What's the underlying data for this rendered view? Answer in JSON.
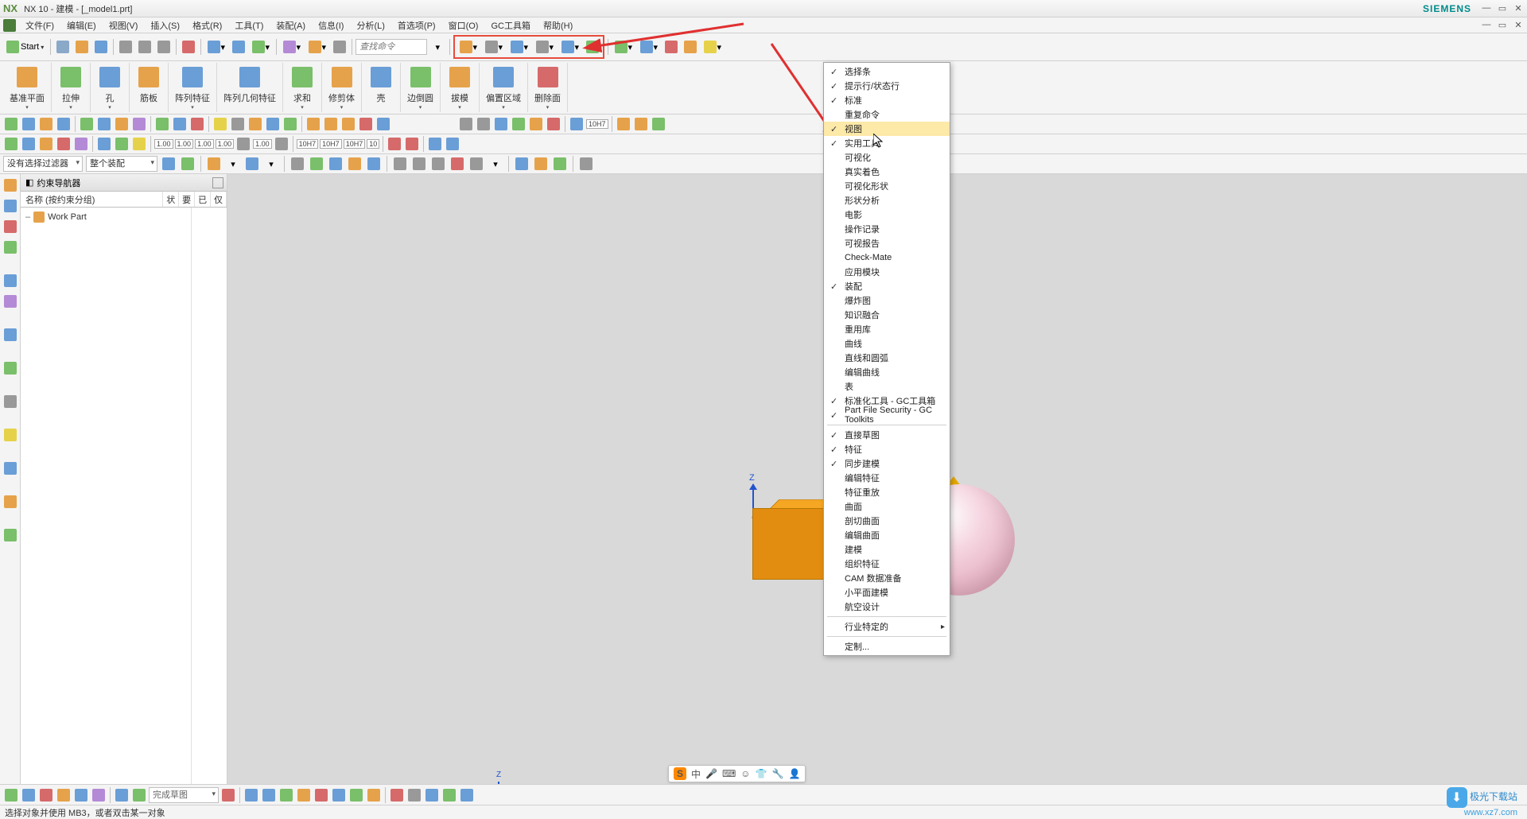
{
  "title": {
    "app": "NX",
    "full": "NX 10 - 建模 - [_model1.prt]",
    "brand": "SIEMENS"
  },
  "menus": [
    "文件(F)",
    "编辑(E)",
    "视图(V)",
    "插入(S)",
    "格式(R)",
    "工具(T)",
    "装配(A)",
    "信息(I)",
    "分析(L)",
    "首选项(P)",
    "窗口(O)",
    "GC工具箱",
    "帮助(H)"
  ],
  "toolbar1": {
    "start": "Start",
    "search_placeholder": "查找命令"
  },
  "ribbon": [
    {
      "label": "基准平面"
    },
    {
      "label": "拉伸"
    },
    {
      "label": "孔"
    },
    {
      "label": "筋板"
    },
    {
      "label": "阵列特征"
    },
    {
      "label": "阵列几何特征"
    },
    {
      "label": "求和"
    },
    {
      "label": "修剪体"
    },
    {
      "label": "壳"
    },
    {
      "label": "边倒圆"
    },
    {
      "label": "拔模"
    },
    {
      "label": "偏置区域"
    },
    {
      "label": "删除面"
    }
  ],
  "dim_values": [
    "1.00",
    "1.00",
    "1.00",
    "1.00",
    "1.00",
    "10H7",
    "10H7",
    "10H7",
    "10"
  ],
  "filter": {
    "no_filter": "没有选择过滤器",
    "assembly": "整个装配"
  },
  "nav": {
    "title": "约束导航器",
    "col1": "名称 (按约束分组)",
    "cols": [
      "状",
      "要",
      "已",
      "仅"
    ],
    "item": "Work Part"
  },
  "ctx": {
    "items": [
      {
        "t": "选择条",
        "c": true
      },
      {
        "t": "提示行/状态行",
        "c": true
      },
      {
        "t": "标准",
        "c": true
      },
      {
        "t": "重复命令",
        "c": false
      },
      {
        "t": "视图",
        "c": true,
        "hover": true
      },
      {
        "t": "实用工具",
        "c": true
      },
      {
        "t": "可视化",
        "c": false
      },
      {
        "t": "真实着色",
        "c": false
      },
      {
        "t": "可视化形状",
        "c": false
      },
      {
        "t": "形状分析",
        "c": false
      },
      {
        "t": "电影",
        "c": false
      },
      {
        "t": "操作记录",
        "c": false
      },
      {
        "t": "可视报告",
        "c": false
      },
      {
        "t": "Check-Mate",
        "c": false
      },
      {
        "t": "应用模块",
        "c": false
      },
      {
        "t": "装配",
        "c": true
      },
      {
        "t": "爆炸图",
        "c": false
      },
      {
        "t": "知识融合",
        "c": false
      },
      {
        "t": "重用库",
        "c": false
      },
      {
        "t": "曲线",
        "c": false
      },
      {
        "t": "直线和圆弧",
        "c": false
      },
      {
        "t": "编辑曲线",
        "c": false
      },
      {
        "t": "表",
        "c": false
      },
      {
        "t": "标准化工具 - GC工具箱",
        "c": true
      },
      {
        "t": "Part File Security - GC Toolkits",
        "c": true
      },
      {
        "sep": true
      },
      {
        "t": "直接草图",
        "c": true
      },
      {
        "t": "特征",
        "c": true
      },
      {
        "t": "同步建模",
        "c": true
      },
      {
        "t": "编辑特征",
        "c": false
      },
      {
        "t": "特征重放",
        "c": false
      },
      {
        "t": "曲面",
        "c": false
      },
      {
        "t": "剖切曲面",
        "c": false
      },
      {
        "t": "编辑曲面",
        "c": false
      },
      {
        "t": "建模",
        "c": false
      },
      {
        "t": "组织特征",
        "c": false
      },
      {
        "t": "CAM 数据准备",
        "c": false
      },
      {
        "t": "小平面建模",
        "c": false
      },
      {
        "t": "航空设计",
        "c": false
      },
      {
        "sep": true
      },
      {
        "t": "行业特定的",
        "c": false,
        "arrow": true
      },
      {
        "sep": true
      },
      {
        "t": "定制...",
        "c": false
      }
    ]
  },
  "ime": {
    "zhong": "中"
  },
  "bottom": {
    "finish": "完成草图"
  },
  "status": "选择对象并使用 MB3，或者双击某一对象",
  "watermark": {
    "line1": "极光下载站",
    "line2": "www.xz7.com"
  }
}
